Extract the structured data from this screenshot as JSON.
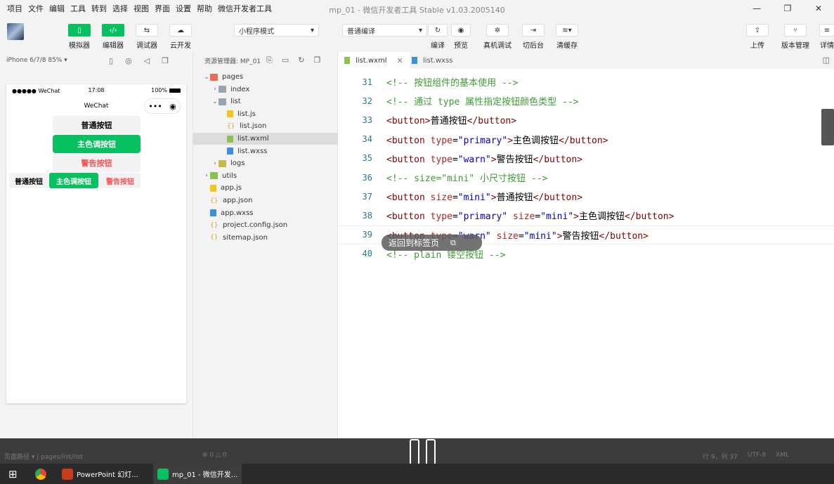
{
  "menubar": {
    "items": [
      "项目",
      "文件",
      "编辑",
      "工具",
      "转到",
      "选择",
      "视图",
      "界面",
      "设置",
      "帮助",
      "微信开发者工具"
    ],
    "title": "mp_01 - 微信开发者工具 Stable v1.03.2005140",
    "controls": [
      "—",
      "❐",
      "✕"
    ]
  },
  "toolbar": {
    "simulator": "模拟器",
    "editor": "编辑器",
    "debugger": "调试器",
    "cloud": "云开发",
    "mode": "小程序模式",
    "compile_mode": "普通编译",
    "compile": "编译",
    "preview": "预览",
    "remote_debug": "真机调试",
    "background": "切后台",
    "clear_cache": "清缓存",
    "upload": "上传",
    "version": "版本管理",
    "details": "详情"
  },
  "simulator": {
    "device": "iPhone 6/7/8 85% ▾",
    "status_left": "●●●●● WeChat",
    "time": "17:08",
    "battery": "100%",
    "nav_title": "WeChat",
    "capsule_dots": "•••",
    "capsule_target": "◉",
    "buttons": {
      "default": "普通按钮",
      "primary": "主色调按钮",
      "warn": "警告按钮",
      "mini_default": "普通按钮",
      "mini_primary": "主色调按钮",
      "mini_warn": "警告按钮"
    }
  },
  "explorer": {
    "title": "资源管理器: MP_01",
    "tree": [
      {
        "label": "pages",
        "arrow": "⌄",
        "icon": "folder-red",
        "indent": 0
      },
      {
        "label": "index",
        "arrow": "›",
        "icon": "folder-grey",
        "indent": 1
      },
      {
        "label": "list",
        "arrow": "⌄",
        "icon": "folder-grey",
        "indent": 1
      },
      {
        "label": "list.js",
        "arrow": "",
        "icon": "js",
        "indent": 2
      },
      {
        "label": "list.json",
        "arrow": "",
        "icon": "json",
        "indent": 2
      },
      {
        "label": "list.wxml",
        "arrow": "",
        "icon": "wxml",
        "indent": 2,
        "selected": true
      },
      {
        "label": "list.wxss",
        "arrow": "",
        "icon": "wxss",
        "indent": 2
      },
      {
        "label": "logs",
        "arrow": "›",
        "icon": "folder-yel",
        "indent": 1
      },
      {
        "label": "utils",
        "arrow": "›",
        "icon": "folder-green",
        "indent": 0
      },
      {
        "label": "app.js",
        "arrow": "",
        "icon": "js",
        "indent": 0
      },
      {
        "label": "app.json",
        "arrow": "",
        "icon": "json",
        "indent": 0
      },
      {
        "label": "app.wxss",
        "arrow": "",
        "icon": "wxss",
        "indent": 0
      },
      {
        "label": "project.config.json",
        "arrow": "",
        "icon": "json",
        "indent": 0
      },
      {
        "label": "sitemap.json",
        "arrow": "",
        "icon": "json",
        "indent": 0
      }
    ]
  },
  "tabs": [
    {
      "label": "list.wxml",
      "close": "✕",
      "active": true
    },
    {
      "label": "list.wxss",
      "active": false
    }
  ],
  "editor": {
    "lines": [
      {
        "n": "31",
        "parts": [
          [
            "cm",
            "<!-- 按钮组件的基本使用 -->"
          ]
        ]
      },
      {
        "n": "32",
        "parts": [
          [
            "cm",
            "<!-- 通过 type 属性指定按钮颜色类型 -->"
          ]
        ]
      },
      {
        "n": "33",
        "parts": [
          [
            "tag",
            "<button>"
          ],
          [
            "txt",
            "普通按钮"
          ],
          [
            "tag",
            "</button>"
          ]
        ]
      },
      {
        "n": "34",
        "parts": [
          [
            "tag",
            "<button "
          ],
          [
            "attr",
            "type"
          ],
          [
            "txt",
            "="
          ],
          [
            "val",
            "\"primary\""
          ],
          [
            "tag",
            ">"
          ],
          [
            "txt",
            "主色调按钮"
          ],
          [
            "tag",
            "</button>"
          ]
        ]
      },
      {
        "n": "35",
        "parts": [
          [
            "tag",
            "<button "
          ],
          [
            "attr",
            "type"
          ],
          [
            "txt",
            "="
          ],
          [
            "val",
            "\"warn\""
          ],
          [
            "tag",
            ">"
          ],
          [
            "txt",
            "警告按钮"
          ],
          [
            "tag",
            "</button>"
          ]
        ]
      },
      {
        "n": "36",
        "parts": [
          [
            "cm",
            "<!-- size=\"mini\" 小尺寸按钮 -->"
          ]
        ]
      },
      {
        "n": "37",
        "parts": [
          [
            "tag",
            "<button "
          ],
          [
            "attr",
            "size"
          ],
          [
            "txt",
            "="
          ],
          [
            "val",
            "\"mini\""
          ],
          [
            "tag",
            ">"
          ],
          [
            "txt",
            "普通按钮"
          ],
          [
            "tag",
            "</button>"
          ]
        ]
      },
      {
        "n": "38",
        "parts": [
          [
            "tag",
            "<button "
          ],
          [
            "attr",
            "type"
          ],
          [
            "txt",
            "="
          ],
          [
            "val",
            "\"primary\""
          ],
          [
            "tag",
            " "
          ],
          [
            "attr",
            "size"
          ],
          [
            "txt",
            "="
          ],
          [
            "val",
            "\"mini\""
          ],
          [
            "tag",
            ">"
          ],
          [
            "txt",
            "主色调按钮"
          ],
          [
            "tag",
            "</button>"
          ]
        ]
      },
      {
        "n": "39",
        "parts": [
          [
            "tag",
            "<button "
          ],
          [
            "attr",
            "type"
          ],
          [
            "txt",
            "="
          ],
          [
            "val",
            "\"warn\""
          ],
          [
            "tag",
            " "
          ],
          [
            "attr",
            "size"
          ],
          [
            "txt",
            "="
          ],
          [
            "val",
            "\"mini\""
          ],
          [
            "tag",
            ">"
          ],
          [
            "txt",
            "警告按钮"
          ],
          [
            "tag",
            "</button>"
          ]
        ],
        "current": true
      },
      {
        "n": "40",
        "parts": [
          [
            "cm",
            "<!-- plain 镂空按钮 -->"
          ]
        ]
      }
    ]
  },
  "toast": {
    "text": "返回到标签页",
    "icon": "⧉"
  },
  "statusbar": {
    "path_label": "页面路径 ▾",
    "path": "pages/list/list",
    "errors": "⊗ 0 △ 0",
    "cursor": "行 9，列 37",
    "encoding": "UTF-8",
    "lang": "XML"
  },
  "taskbar": {
    "start": "⊞",
    "ppt": "PowerPoint 幻灯...",
    "devtool": "mp_01 - 微信开发..."
  },
  "colors": {
    "primary": "#07c160",
    "warn": "#fa5151",
    "comment": "#3d9b35",
    "tag": "#800000",
    "attr": "#b22222",
    "value": "#0000cd"
  }
}
